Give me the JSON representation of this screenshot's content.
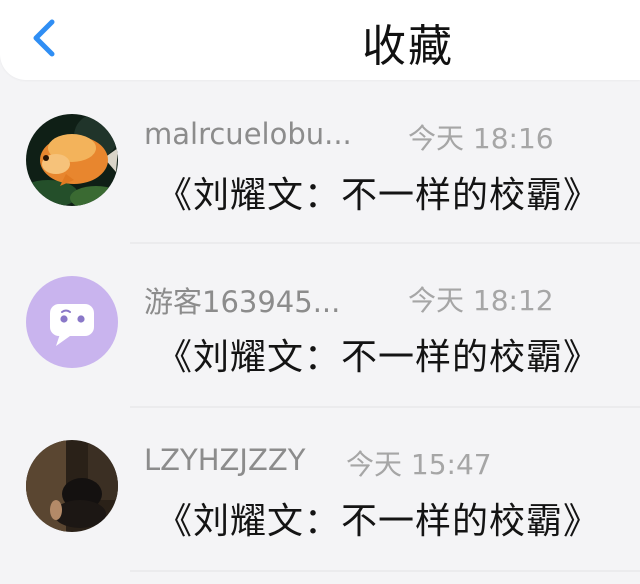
{
  "header": {
    "title": "收藏"
  },
  "favorites": [
    {
      "name": "malrcuelobu...",
      "time": "今天 18:16",
      "message": "《刘耀文：不一样的校霸》"
    },
    {
      "name": "游客163945...",
      "time": "今天 18:12",
      "message": "《刘耀文：不一样的校霸》"
    },
    {
      "name": "LZYHZJZZY",
      "time": "今天 15:47",
      "message": "《刘耀文：不一样的校霸》"
    }
  ],
  "colors": {
    "accent": "#2f8ef4",
    "default_avatar_bg": "#c9b4ee"
  },
  "icons": {
    "back": "chevron-left-icon",
    "default_avatar": "chat-bubble-icon"
  }
}
